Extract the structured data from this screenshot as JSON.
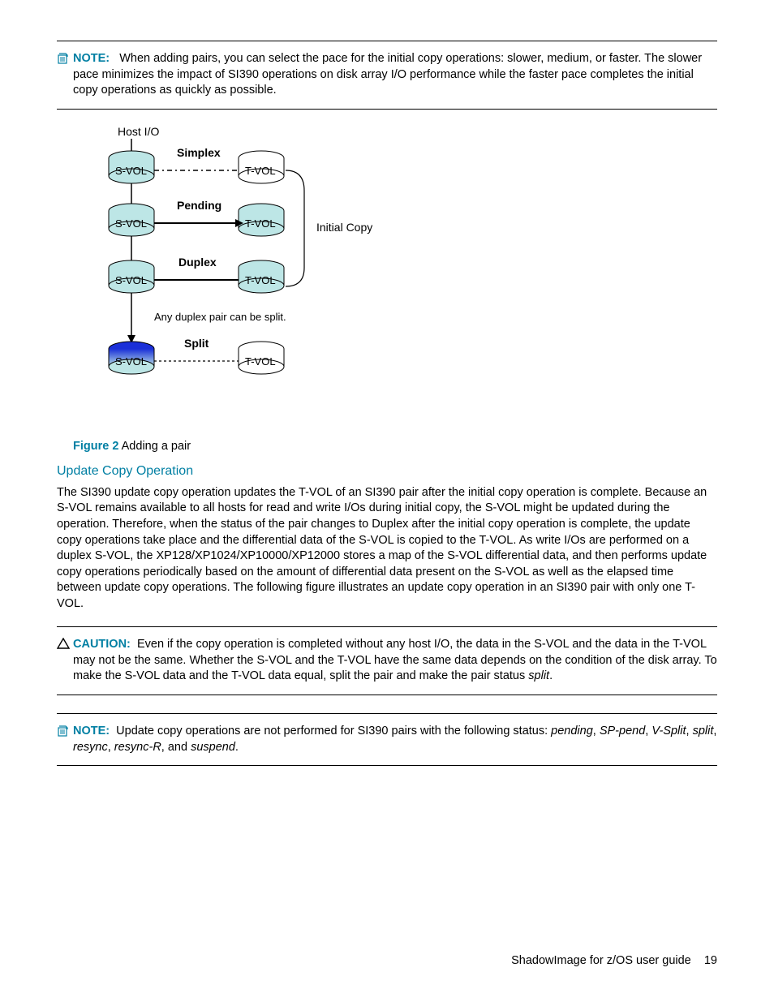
{
  "note1": {
    "label": "NOTE:",
    "text": "When adding pairs, you can select the pace for the initial copy operations: slower, medium, or faster. The slower pace minimizes the impact of SI390 operations on disk array I/O performance while the faster pace completes the initial copy operations as quickly as possible."
  },
  "diagram": {
    "host_io": "Host I/O",
    "simplex": "Simplex",
    "pending": "Pending",
    "duplex": "Duplex",
    "split": "Split",
    "svol": "S-VOL",
    "tvol": "T-VOL",
    "initial_copy": "Initial Copy",
    "split_caption": "Any duplex pair can be split."
  },
  "figure": {
    "label": "Figure 2",
    "caption": "Adding a pair"
  },
  "section_title": "Update Copy Operation",
  "body_para": "The SI390 update copy operation updates the T-VOL of an SI390 pair after the initial copy operation is complete. Because an S-VOL remains available to all hosts for read and write I/Os during initial copy, the S-VOL might be updated during the operation. Therefore, when the status of the pair changes to Duplex after the initial copy operation is complete, the update copy operations take place and the differential data of the S-VOL is copied to the T-VOL. As write I/Os are performed on a duplex S-VOL, the XP128/XP1024/XP10000/XP12000 stores a map of the S-VOL differential data, and then performs update copy operations periodically based on the amount of differential data present on the S-VOL as well as the elapsed time between update copy operations. The following figure illustrates an update copy operation in an SI390 pair with only one T-VOL.",
  "caution": {
    "label": "CAUTION:",
    "text_a": "Even if the copy operation is completed without any host I/O, the data in the S-VOL and the data in the T-VOL may not be the same. Whether the S-VOL and the T-VOL have the same data depends on the condition of the disk array. To make the S-VOL data and the T-VOL data equal, split the pair and make the pair status ",
    "text_b": "split",
    "text_c": "."
  },
  "note2": {
    "label": "NOTE:",
    "pre": "Update copy operations are not performed for SI390 pairs with the following status: ",
    "s1": "pending",
    "s2": "SP-pend",
    "s3": "V-Split",
    "s4": "split",
    "s5": "resync",
    "s6": "resync-R",
    "s7": "suspend"
  },
  "footer": {
    "title": "ShadowImage for z/OS user guide",
    "page": "19"
  }
}
